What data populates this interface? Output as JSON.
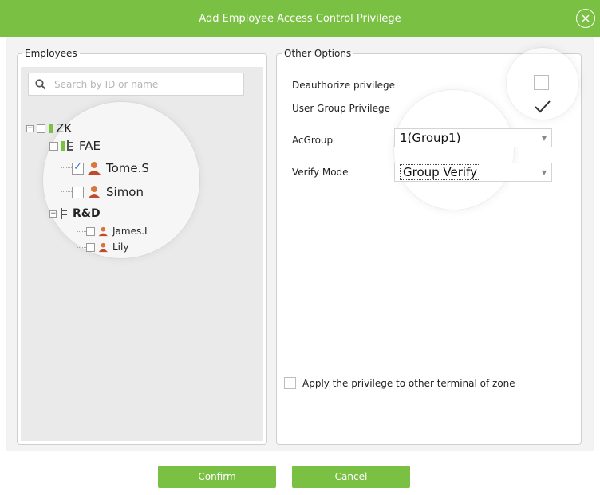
{
  "window": {
    "title": "Add Employee Access Control Privilege",
    "close_label": "×"
  },
  "employees": {
    "legend": "Employees",
    "search_placeholder": "Search by ID or name",
    "tree": {
      "root": "ZK",
      "departments": [
        {
          "name": "FAE",
          "members": [
            {
              "name": "Tome.S",
              "checked": true
            },
            {
              "name": "Simon",
              "checked": false
            }
          ]
        },
        {
          "name": "R&D",
          "members": [
            {
              "name": "James.L",
              "checked": false
            },
            {
              "name": "Lily",
              "checked": false
            }
          ]
        }
      ]
    }
  },
  "options": {
    "legend": "Other Options",
    "deauthorize_label": "Deauthorize privilege",
    "deauthorize_checked": false,
    "user_group_label": "User Group Privilege",
    "user_group_checked": true,
    "acgroup_label": "AcGroup",
    "acgroup_value": "1(Group1)",
    "verify_mode_label": "Verify Mode",
    "verify_mode_value": "Group Verify",
    "apply_label": "Apply the privilege to other terminal of zone",
    "apply_checked": false
  },
  "footer": {
    "confirm_label": "Confirm",
    "cancel_label": "Cancel"
  },
  "colors": {
    "accent": "#7ac143",
    "panel_bg": "#eaeaea"
  },
  "icons": [
    "close-icon",
    "search-icon",
    "department-icon",
    "user-icon",
    "dropdown-arrow-icon",
    "checkmark-icon"
  ]
}
